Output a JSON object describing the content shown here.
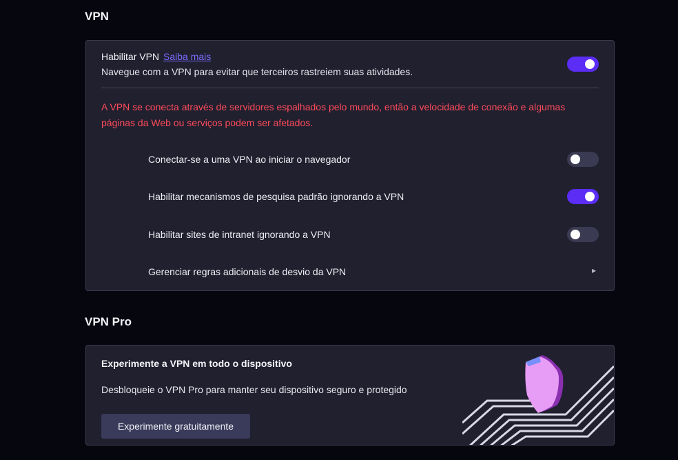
{
  "vpn_section": {
    "title": "VPN",
    "enable": {
      "label": "Habilitar VPN",
      "learn_more": "Saiba mais",
      "description": "Navegue com a VPN para evitar que terceiros rastreiem suas atividades.",
      "enabled": true
    },
    "warning": "A VPN se conecta através de servidores espalhados pelo mundo, então a velocidade de conexão e algumas páginas da Web ou serviços podem ser afetados.",
    "options": [
      {
        "label": "Conectar-se a uma VPN ao iniciar o navegador",
        "enabled": false
      },
      {
        "label": "Habilitar mecanismos de pesquisa padrão ignorando a VPN",
        "enabled": true
      },
      {
        "label": "Habilitar sites de intranet ignorando a VPN",
        "enabled": false
      }
    ],
    "manage_rules": {
      "label": "Gerenciar regras adicionais de desvio da VPN",
      "icon": "chevron-right-icon"
    }
  },
  "vpn_pro_section": {
    "title": "VPN Pro",
    "heading": "Experimente a VPN em todo o dispositivo",
    "description": "Desbloqueie o VPN Pro para manter seu dispositivo seguro e protegido",
    "button_label": "Experimente gratuitamente",
    "illustration": "shield-icon"
  },
  "colors": {
    "background": "#06060f",
    "card": "#20202f",
    "accent": "#5b2df5",
    "link": "#7b6cff",
    "warning": "#ff4a5a",
    "shield": "#e07ef0"
  }
}
